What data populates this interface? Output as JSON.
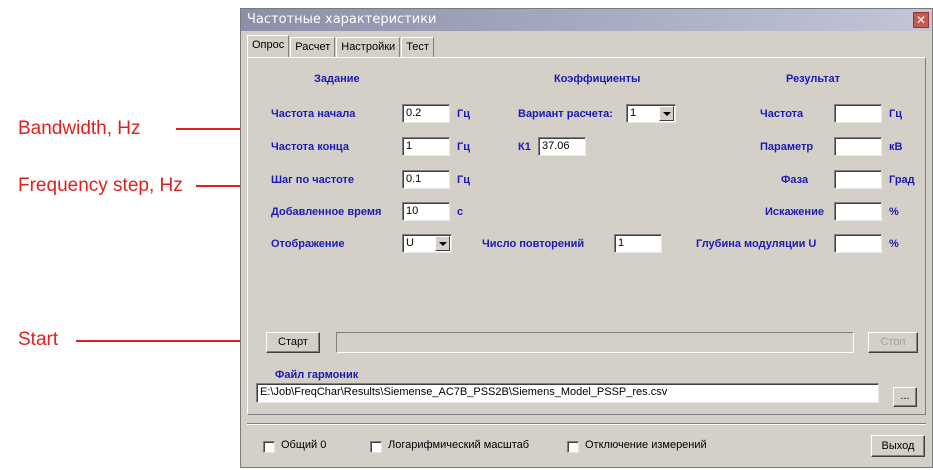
{
  "annotations": {
    "bandwidth": "Bandwidth, Hz",
    "frequency_step": "Frequency step, Hz",
    "start": "Start"
  },
  "window": {
    "title": "Частотные характеристики",
    "close_glyph": "✕"
  },
  "tabs": [
    "Опрос",
    "Расчет",
    "Настройки",
    "Тест"
  ],
  "headers": {
    "task": "Задание",
    "coefficients": "Коэффициенты",
    "result": "Результат"
  },
  "task": {
    "start_freq_label": "Частота начала",
    "start_freq_value": "0.2",
    "end_freq_label": "Частота конца",
    "end_freq_value": "1",
    "step_label": "Шаг по частоте",
    "step_value": "0.1",
    "added_time_label": "Добавленное время",
    "added_time_value": "10",
    "added_time_unit": "с",
    "display_label": "Отображение",
    "display_value": "U",
    "unit_hz": "Гц"
  },
  "coefficients": {
    "variant_label": "Вариант расчета:",
    "variant_value": "1",
    "k1_label": "К1",
    "k1_value": "37.06",
    "repeats_label": "Число повторений",
    "repeats_value": "1"
  },
  "result": {
    "freq_label": "Частота",
    "freq_unit": "Гц",
    "param_label": "Параметр",
    "param_unit": "кВ",
    "phase_label": "Фаза",
    "phase_unit": "Град",
    "distortion_label": "Искажение",
    "distortion_unit": "%",
    "modulation_label": "Глубина модуляции U",
    "modulation_unit": "%"
  },
  "controls": {
    "start_button": "Старт",
    "stop_button": "Стоп",
    "harmonics_file_label": "Файл гармоник",
    "harmonics_file_path": "E:\\Job\\FreqChar\\Results\\Siemense_AC7B_PSS2B\\Siemens_Model_PSSP_res.csv",
    "browse_button": "...",
    "common_zero": "Общий 0",
    "log_scale": "Логарифмический масштаб",
    "disable_measurements": "Отключение измерений",
    "exit_button": "Выход"
  },
  "colors": {
    "annotation": "#e0201e",
    "label_blue": "#1a1ab5",
    "dialog_face": "#d4d0c8"
  }
}
